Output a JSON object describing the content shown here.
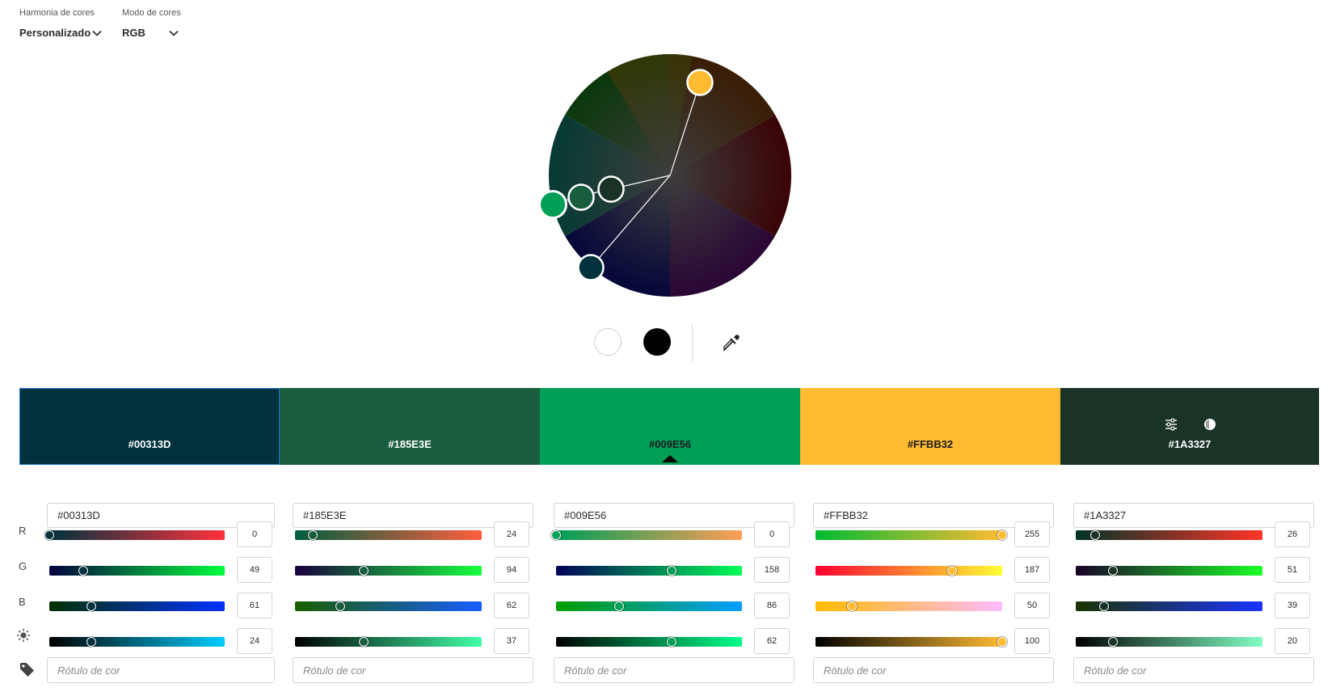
{
  "harmony": {
    "label": "Harmonia de cores",
    "value": "Personalizado"
  },
  "mode": {
    "label": "Modo de cores",
    "value": "RGB"
  },
  "icons": {
    "chevron": "chevron-down-icon",
    "eyedropper": "eyedropper-icon",
    "brightness": "brightness-icon",
    "tag": "tag-icon",
    "adjust": "sliders-adjust-icon",
    "contrast": "contrast-icon"
  },
  "row_labels": {
    "r": "R",
    "g": "G",
    "b": "B"
  },
  "label_placeholder": "Rótulo de cor",
  "selected_index": 2,
  "swatches": [
    {
      "hex": "#00313D",
      "color": "#00313D",
      "text_color": "#ffffff",
      "r": "0",
      "g": "49",
      "b": "61",
      "brightness": "24",
      "r_val": 0,
      "g_val": 49,
      "b_val": 61,
      "bright_val": 24
    },
    {
      "hex": "#185E3E",
      "color": "#185E3E",
      "text_color": "#ffffff",
      "r": "24",
      "g": "94",
      "b": "62",
      "brightness": "37",
      "r_val": 24,
      "g_val": 94,
      "b_val": 62,
      "bright_val": 37
    },
    {
      "hex": "#009E56",
      "color": "#009E56",
      "text_color": "#1d1d1d",
      "r": "0",
      "g": "158",
      "b": "86",
      "brightness": "62",
      "r_val": 0,
      "g_val": 158,
      "b_val": 86,
      "bright_val": 62
    },
    {
      "hex": "#FFBB32",
      "color": "#FFBB32",
      "text_color": "#1d1d1d",
      "r": "255",
      "g": "187",
      "b": "50",
      "brightness": "100",
      "r_val": 255,
      "g_val": 187,
      "b_val": 50,
      "bright_val": 100
    },
    {
      "hex": "#1A3327",
      "color": "#1A3327",
      "text_color": "#ffffff",
      "r": "26",
      "g": "51",
      "b": "39",
      "brightness": "20",
      "r_val": 26,
      "g_val": 51,
      "b_val": 39,
      "bright_val": 20
    }
  ]
}
